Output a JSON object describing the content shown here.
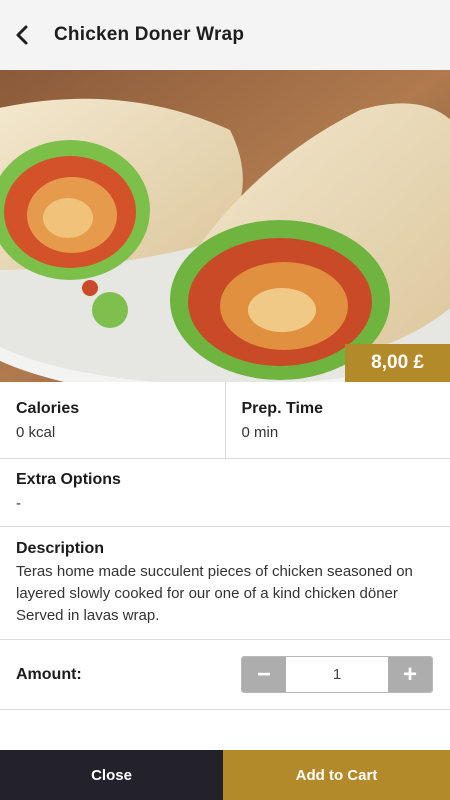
{
  "header": {
    "title": "Chicken Doner Wrap",
    "back_icon": "chevron-left-icon"
  },
  "product": {
    "price": "8,00 £",
    "image": "wrap-photo"
  },
  "info": {
    "calories_label": "Calories",
    "calories_value": "0 kcal",
    "prep_label": "Prep. Time",
    "prep_value": "0 min"
  },
  "extra": {
    "label": "Extra Options",
    "value": "-"
  },
  "description": {
    "label": "Description",
    "text": "Teras home made succulent pieces of chicken seasoned on layered slowly cooked for our one of a kind chicken döner Served in lavas wrap."
  },
  "amount": {
    "label": "Amount:",
    "quantity": "1",
    "decrement": "−",
    "increment": "+"
  },
  "footer": {
    "close_label": "Close",
    "add_label": "Add to Cart"
  },
  "colors": {
    "accent": "#b38a2a",
    "dark": "#23222a",
    "stepper": "#adadad"
  }
}
